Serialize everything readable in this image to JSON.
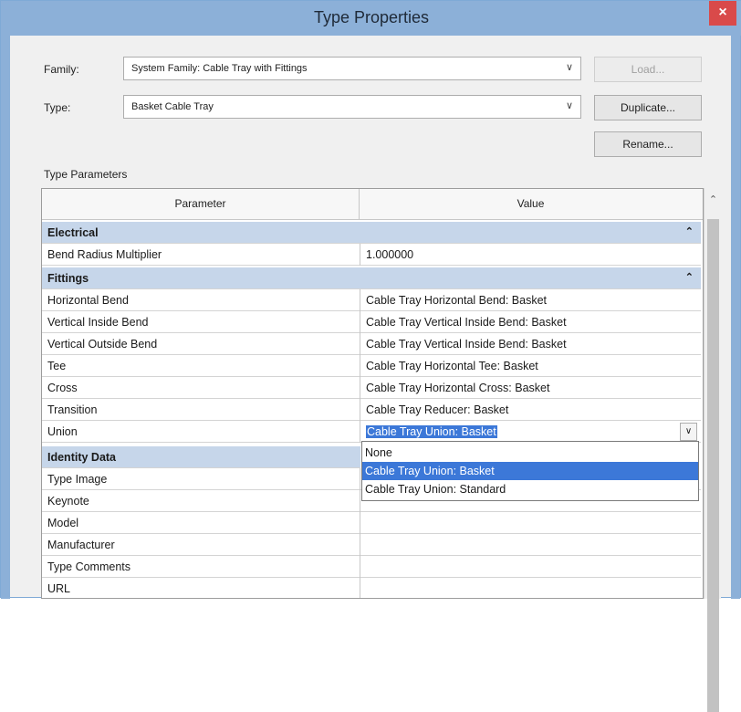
{
  "window": {
    "title": "Type Properties",
    "close_glyph": "×"
  },
  "family": {
    "label": "Family:",
    "value": "System Family: Cable Tray with Fittings"
  },
  "type": {
    "label": "Type:",
    "value": "Basket Cable Tray"
  },
  "buttons": {
    "load": "Load...",
    "duplicate": "Duplicate...",
    "rename": "Rename..."
  },
  "section_label": "Type Parameters",
  "columns": {
    "parameter": "Parameter",
    "value": "Value"
  },
  "groups": {
    "electrical": "Electrical",
    "fittings": "Fittings",
    "identity": "Identity Data"
  },
  "rows": {
    "bend_radius": {
      "p": "Bend Radius Multiplier",
      "v": "1.000000"
    },
    "horizontal_bend": {
      "p": "Horizontal Bend",
      "v": "Cable Tray Horizontal Bend: Basket"
    },
    "vertical_inside": {
      "p": "Vertical Inside Bend",
      "v": "Cable Tray Vertical Inside Bend: Basket"
    },
    "vertical_outside": {
      "p": "Vertical Outside Bend",
      "v": "Cable Tray Vertical Inside Bend: Basket"
    },
    "tee": {
      "p": "Tee",
      "v": "Cable Tray Horizontal Tee: Basket"
    },
    "cross": {
      "p": "Cross",
      "v": "Cable Tray Horizontal Cross: Basket"
    },
    "transition": {
      "p": "Transition",
      "v": "Cable Tray Reducer: Basket"
    },
    "union": {
      "p": "Union",
      "v": "Cable Tray Union: Basket"
    },
    "type_image": {
      "p": "Type Image",
      "v": ""
    },
    "keynote": {
      "p": "Keynote",
      "v": ""
    },
    "model": {
      "p": "Model",
      "v": ""
    },
    "manufacturer": {
      "p": "Manufacturer",
      "v": ""
    },
    "type_comments": {
      "p": "Type Comments",
      "v": ""
    },
    "url": {
      "p": "URL",
      "v": ""
    }
  },
  "union_options": [
    "None",
    "Cable Tray Union: Basket",
    "Cable Tray Union: Standard"
  ],
  "union_selected_index": 1,
  "colors": {
    "accent": "#3c78d8",
    "group_bg": "#c6d6ea",
    "titlebar": "#8cb0d8",
    "close": "#d94a4a"
  }
}
